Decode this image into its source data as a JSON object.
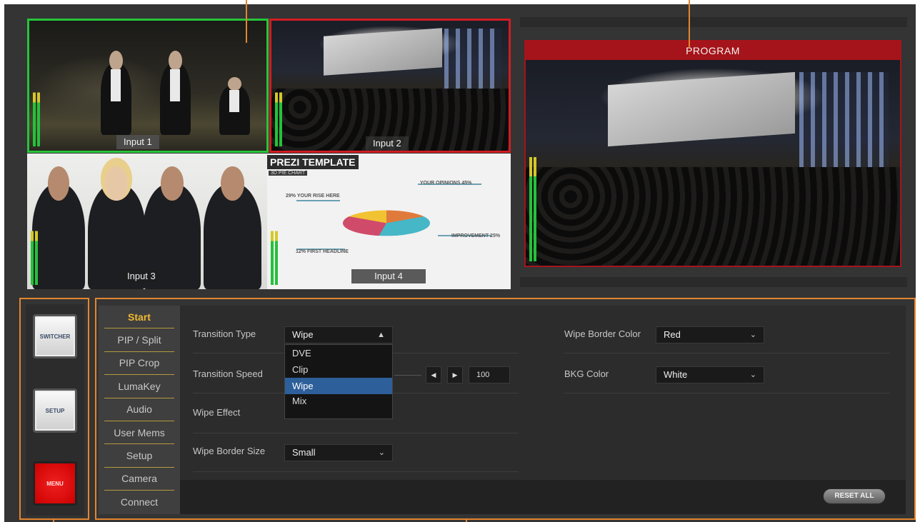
{
  "multiview": {
    "inputs": [
      {
        "label": "Input 1"
      },
      {
        "label": "Input 2"
      },
      {
        "label": "Input 3"
      },
      {
        "label": "Input 4"
      }
    ],
    "input4_overlay": {
      "title": "PREZI TEMPLATE",
      "subtitle": "3D PIE CHART",
      "texts": [
        "29% YOUR RISE HERE",
        "YOUR OPINIONS 45%",
        "IMPROVEMENT 25%",
        "12% FIRST HEADLINE"
      ]
    },
    "tally": {
      "preview_color": "#27c43a",
      "program_color": "#d21c22"
    }
  },
  "program": {
    "label": "PROGRAM"
  },
  "sidebar": {
    "buttons": [
      {
        "label": "SWITCHER"
      },
      {
        "label": "SETUP"
      },
      {
        "label": "MENU"
      }
    ]
  },
  "tabs": [
    {
      "label": "Start",
      "active": true
    },
    {
      "label": "PIP / Split"
    },
    {
      "label": "PIP Crop"
    },
    {
      "label": "LumaKey"
    },
    {
      "label": "Audio"
    },
    {
      "label": "User Mems"
    },
    {
      "label": "Setup"
    },
    {
      "label": "Camera"
    },
    {
      "label": "Connect"
    }
  ],
  "start": {
    "transition_type": {
      "label": "Transition Type",
      "value": "Wipe",
      "options": [
        "DVE",
        "Clip",
        "Wipe",
        "Mix"
      ],
      "selected": "Wipe"
    },
    "transition_speed": {
      "label": "Transition Speed",
      "value": "100"
    },
    "wipe_effect": {
      "label": "Wipe Effect"
    },
    "wipe_border_size": {
      "label": "Wipe Border Size",
      "value": "Small"
    },
    "wipe_border_color": {
      "label": "Wipe Border Color",
      "value": "Red"
    },
    "bkg_color": {
      "label": "BKG Color",
      "value": "White"
    }
  },
  "footer": {
    "reset_label": "RESET ALL"
  },
  "colors": {
    "accent_orange": "#e4852e",
    "active_tab": "#f0b832",
    "selected_option": "#2d5f9a"
  },
  "icons": {
    "dropdown_open": "chevron-up-icon",
    "dropdown_closed": "chevron-down-icon",
    "step_left": "triangle-left-icon",
    "step_right": "triangle-right-icon"
  }
}
